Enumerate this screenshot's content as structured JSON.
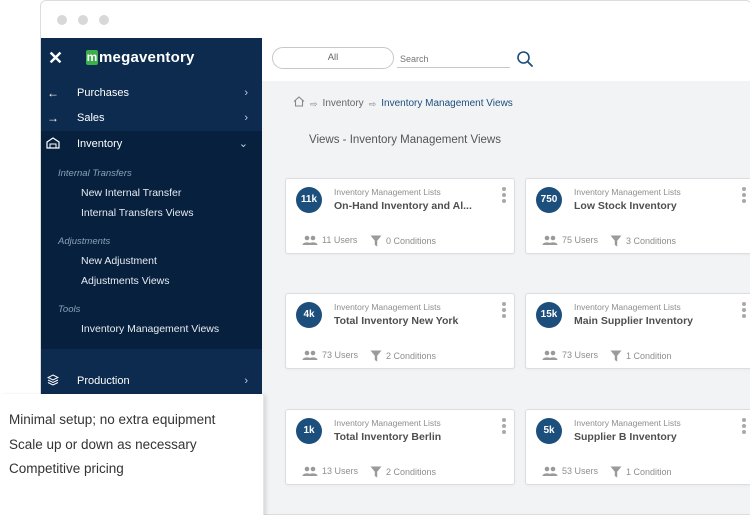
{
  "sidebar": {
    "logo_text": "megaventory",
    "logo_letter": "m",
    "menu": [
      {
        "label": "Purchases"
      },
      {
        "label": "Sales"
      },
      {
        "label": "Inventory"
      }
    ],
    "submenu": {
      "groups": [
        {
          "heading": "Internal Transfers",
          "items": [
            "New Internal Transfer",
            "Internal Transfers Views"
          ]
        },
        {
          "heading": "Adjustments",
          "items": [
            "New Adjustment",
            "Adjustments Views"
          ]
        },
        {
          "heading": "Tools",
          "items": [
            "Inventory Management Views"
          ]
        }
      ]
    },
    "production_label": "Production"
  },
  "topbar": {
    "filter_label": "All",
    "search_placeholder": "Search"
  },
  "breadcrumb": {
    "parent": "Inventory",
    "current": "Inventory Management Views"
  },
  "page_title": "Views - Inventory Management Views",
  "cards": [
    {
      "badge": "11k",
      "subtitle": "Inventory Management Lists",
      "title": "On-Hand Inventory and Al...",
      "users": "11 Users",
      "conditions": "0 Conditions"
    },
    {
      "badge": "750",
      "subtitle": "Inventory Management Lists",
      "title": "Low Stock Inventory",
      "users": "75 Users",
      "conditions": "3 Conditions"
    },
    {
      "badge": "4k",
      "subtitle": "Inventory Management Lists",
      "title": "Total Inventory New York",
      "users": "73 Users",
      "conditions": "2 Conditions"
    },
    {
      "badge": "15k",
      "subtitle": "Inventory Management Lists",
      "title": "Main Supplier Inventory",
      "users": "73 Users",
      "conditions": "1 Condition"
    },
    {
      "badge": "1k",
      "subtitle": "Inventory Management Lists",
      "title": "Total Inventory Berlin",
      "users": "13 Users",
      "conditions": "2 Conditions"
    },
    {
      "badge": "5k",
      "subtitle": "Inventory Management Lists",
      "title": "Supplier B Inventory",
      "users": "53 Users",
      "conditions": "1 Condition"
    }
  ],
  "promo": {
    "lines": [
      "Minimal setup; no extra equipment",
      "Scale up or down as necessary",
      "Competitive pricing"
    ]
  },
  "colors": {
    "sidebar_bg": "#0c2b4f",
    "sidebar_active": "#07203d",
    "accent": "#1c4f7c",
    "logo_green": "#3cae4b"
  }
}
